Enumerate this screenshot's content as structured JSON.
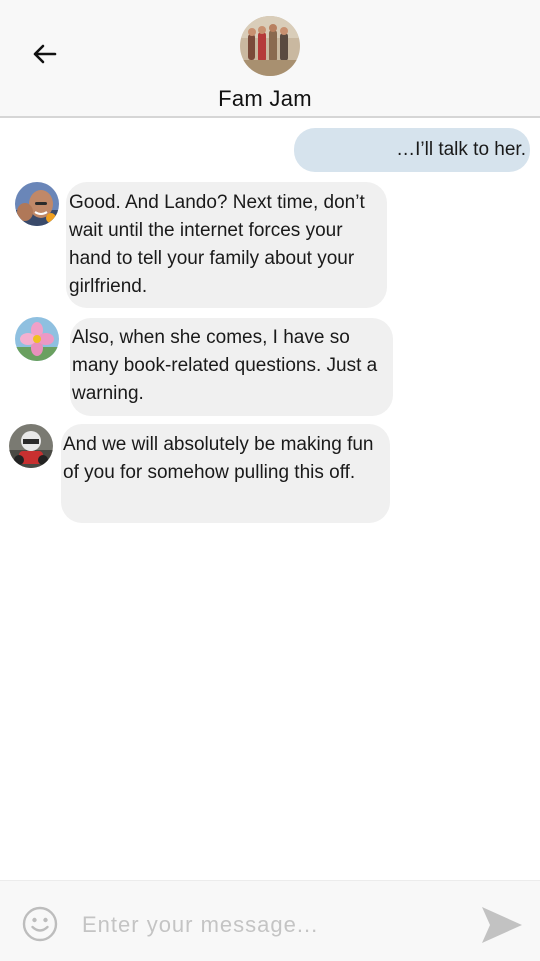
{
  "header": {
    "title": "Fam Jam",
    "back_icon": "arrow-left-icon"
  },
  "messages": [
    {
      "direction": "sent",
      "text": "…I’ll talk to her."
    },
    {
      "direction": "received",
      "avatar": "bald-man-photo",
      "text": "Good. And Lando? Next time, don’t wait until the internet forces your hand to tell your family about your girlfriend."
    },
    {
      "direction": "received",
      "avatar": "pink-flower-photo",
      "text": "Also, when she comes, I have so many book-related questions. Just a warning."
    },
    {
      "direction": "received",
      "avatar": "racer-helmet-photo",
      "text": "And we will absolutely be making fun of you for somehow pulling this off."
    }
  ],
  "composer": {
    "placeholder": "Enter your message...",
    "emoji_icon": "smiley-face-icon",
    "send_icon": "send-arrow-icon"
  },
  "colors": {
    "sent_bubble": "#d6e3ed",
    "received_bubble": "#f0f0f0",
    "header_bg": "#f8f8f8"
  }
}
